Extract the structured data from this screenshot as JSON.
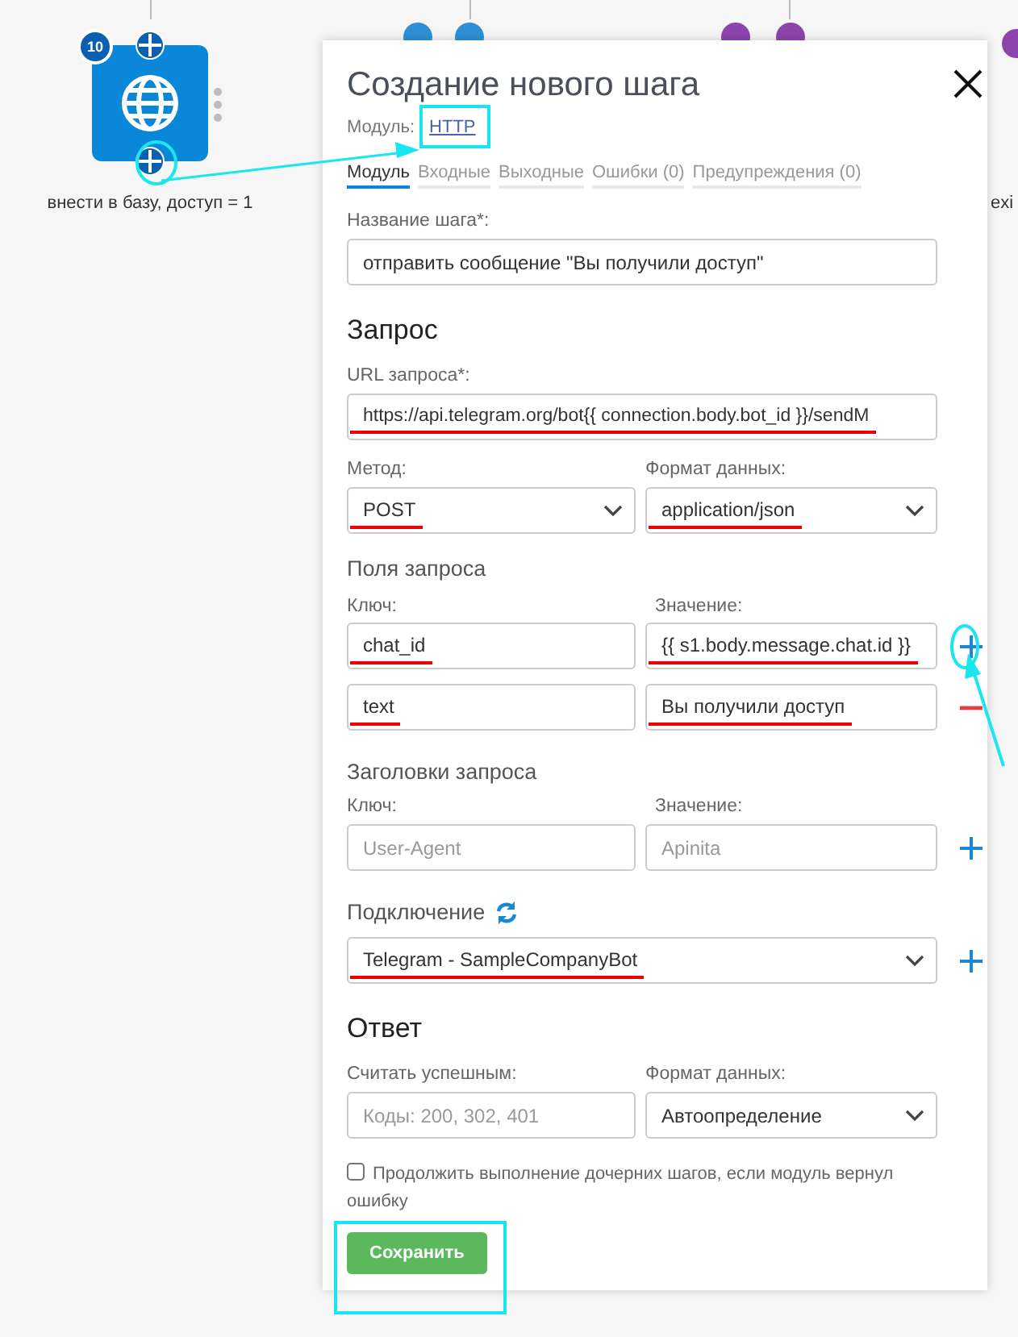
{
  "canvas": {
    "node": {
      "badge": "10",
      "label": "внести в базу, доступ = 1"
    },
    "side_label": "exi"
  },
  "dialog": {
    "title": "Создание нового шага",
    "module_label": "Модуль:",
    "module_link": "HTTP",
    "tabs": [
      {
        "label": "Модуль",
        "selected": true
      },
      {
        "label": "Входные",
        "selected": false
      },
      {
        "label": "Выходные",
        "selected": false
      },
      {
        "label": "Ошибки (0)",
        "selected": false
      },
      {
        "label": "Предупреждения (0)",
        "selected": false
      }
    ],
    "step_name": {
      "label": "Название шага*:",
      "value": "отправить сообщение \"Вы получили доступ\"",
      "underlined": false
    },
    "request": {
      "heading": "Запрос",
      "url": {
        "label": "URL запроса*:",
        "value": "https://api.telegram.org/bot{{ connection.body.bot_id }}/sendM",
        "underlined": true
      },
      "method": {
        "label": "Метод:",
        "value": "POST",
        "underlined": true
      },
      "data_format": {
        "label": "Формат данных:",
        "value": "application/json",
        "underlined": true
      }
    },
    "fields": {
      "heading": "Поля запроса",
      "key_label": "Ключ:",
      "value_label": "Значение:",
      "rows": [
        {
          "key": "chat_id",
          "value": "{{ s1.body.message.chat.id }}",
          "kind": "add",
          "underlined": true
        },
        {
          "key": "text",
          "value": "Вы получили доступ",
          "kind": "remove",
          "underlined": true
        }
      ]
    },
    "headers": {
      "heading": "Заголовки запроса",
      "key_label": "Ключ:",
      "value_label": "Значение:",
      "rows": [
        {
          "key_placeholder": "User-Agent",
          "value_placeholder": "Apinita",
          "kind": "add"
        }
      ]
    },
    "connection": {
      "heading": "Подключение",
      "value": "Telegram - SampleCompanyBot",
      "underlined": true
    },
    "response": {
      "heading": "Ответ",
      "success": {
        "label": "Считать успешным:",
        "placeholder": "Коды: 200, 302, 401"
      },
      "format": {
        "label": "Формат данных:",
        "value": "Автоопределение"
      }
    },
    "continue_on_error": {
      "label": "Продолжить выполнение дочерних шагов, если модуль вернул ошибку",
      "checked": false
    },
    "save_button": "Сохранить"
  }
}
